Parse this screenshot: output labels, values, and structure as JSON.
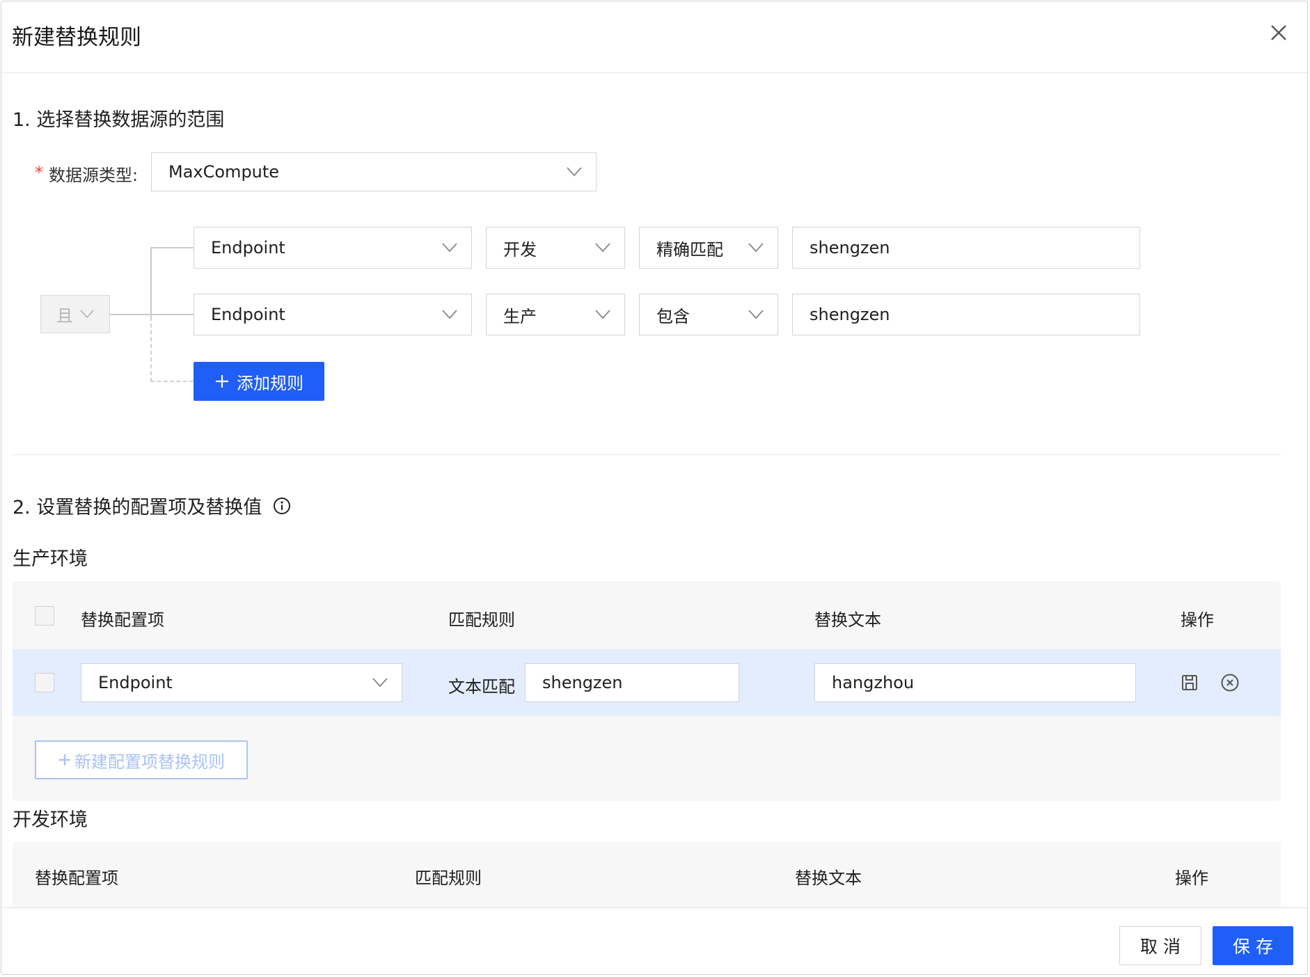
{
  "dialog": {
    "title": "新建替换规则"
  },
  "section1": {
    "title": "1. 选择替换数据源的范围",
    "datasource_label": "数据源类型:",
    "required_mark": "*",
    "datasource_value": "MaxCompute",
    "logic_operator": "且",
    "rules": [
      {
        "field": "Endpoint",
        "env": "开发",
        "match": "精确匹配",
        "value": "shengzen"
      },
      {
        "field": "Endpoint",
        "env": "生产",
        "match": "包含",
        "value": "shengzen"
      }
    ],
    "add_rule_label": "添加规则"
  },
  "section2": {
    "title": "2. 设置替换的配置项及替换值",
    "production": {
      "title": "生产环境",
      "columns": [
        "替换配置项",
        "匹配规则",
        "替换文本",
        "操作"
      ],
      "rows": [
        {
          "item": "Endpoint",
          "match_type": "文本匹配",
          "match_value": "shengzen",
          "replace_text": "hangzhou"
        }
      ],
      "add_label": "新建配置项替换规则"
    },
    "development": {
      "title": "开发环境",
      "columns": [
        "替换配置项",
        "匹配规则",
        "替换文本",
        "操作"
      ]
    }
  },
  "footer": {
    "cancel_label": "取 消",
    "save_label": "保 存"
  },
  "colors": {
    "primary": "#1f5ff7",
    "row_highlight": "#e3edfd",
    "required": "#e5483b"
  }
}
